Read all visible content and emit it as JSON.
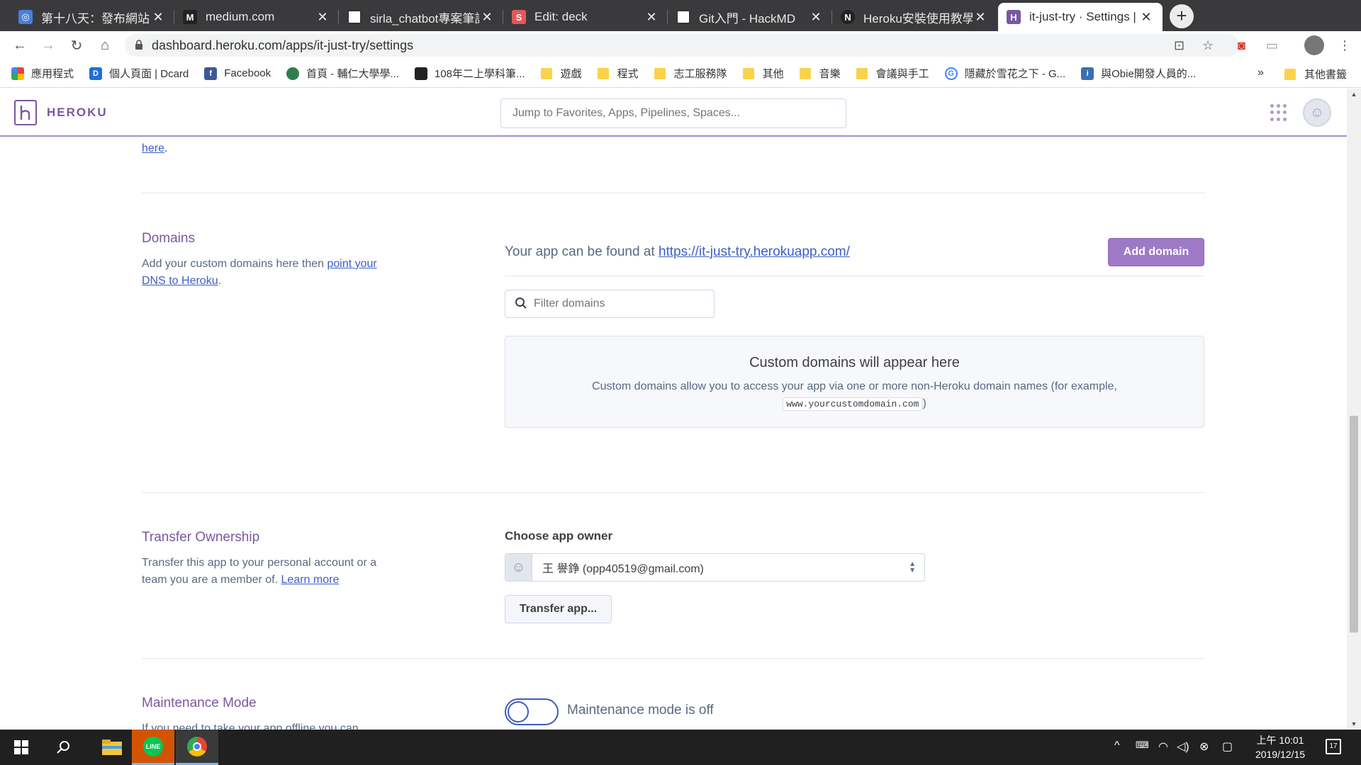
{
  "browser": {
    "tabs": [
      {
        "title": "第十八天：發布網站到",
        "favicon": "site-icon",
        "favicon_color": "#4a7fd6"
      },
      {
        "title": "medium.com",
        "favicon": "medium-icon",
        "favicon_color": "#222222"
      },
      {
        "title": "sirla_chatbot專案筆記",
        "favicon": "doc-icon",
        "favicon_color": "#333333"
      },
      {
        "title": "Edit: deck",
        "favicon": "slides-icon",
        "favicon_color": "#e05a5a"
      },
      {
        "title": "Git入門 - HackMD",
        "favicon": "doc-icon",
        "favicon_color": "#333333"
      },
      {
        "title": "Heroku安裝使用教學",
        "favicon": "notion-icon",
        "favicon_color": "#222222"
      },
      {
        "title": "it-just-try · Settings | H",
        "favicon": "heroku-icon",
        "favicon_color": "#79589f"
      }
    ],
    "new_tab_label": "+",
    "address": "dashboard.heroku.com/apps/it-just-try/settings",
    "bookmarks": [
      {
        "label": "應用程式",
        "icon": "apps-grid-icon",
        "color": "#e94235"
      },
      {
        "label": "個人頁面 | Dcard",
        "icon": "dcard-icon",
        "color": "#1f6fd6"
      },
      {
        "label": "Facebook",
        "icon": "facebook-icon",
        "color": "#3b5998"
      },
      {
        "label": "首頁 - 輔仁大學學...",
        "icon": "school-icon",
        "color": "#2f7d4f"
      },
      {
        "label": "108年二上學科筆...",
        "icon": "doc-icon",
        "color": "#222222"
      },
      {
        "label": "遊戲",
        "icon": "folder-icon",
        "color": "#f9d34c"
      },
      {
        "label": "程式",
        "icon": "folder-icon",
        "color": "#f9d34c"
      },
      {
        "label": "志工服務隊",
        "icon": "folder-icon",
        "color": "#f9d34c"
      },
      {
        "label": "其他",
        "icon": "folder-icon",
        "color": "#f9d34c"
      },
      {
        "label": "音樂",
        "icon": "folder-icon",
        "color": "#f9d34c"
      },
      {
        "label": "會議與手工",
        "icon": "folder-icon",
        "color": "#f9d34c"
      },
      {
        "label": "隱藏於雪花之下 - G...",
        "icon": "google-icon",
        "color": "#4285f4"
      },
      {
        "label": "與Obie開發人員的...",
        "icon": "info-icon",
        "color": "#3a6fb0"
      }
    ],
    "bookmarks_more": "»",
    "other_bookmarks": "其他書籤"
  },
  "heroku": {
    "logo_text": "HEROKU",
    "search_placeholder": "Jump to Favorites, Apps, Pipelines, Spaces...",
    "accent": "#79589f"
  },
  "top_cut": {
    "link": "here",
    "suffix": "."
  },
  "domains": {
    "title": "Domains",
    "desc_prefix": "Add your custom domains here then ",
    "desc_link": "point your DNS to Heroku",
    "desc_suffix": ".",
    "found_prefix": "Your app can be found at ",
    "found_link": "https://it-just-try.herokuapp.com/",
    "add_button": "Add domain",
    "filter_placeholder": "Filter domains",
    "empty_title": "Custom domains will appear here",
    "empty_text": "Custom domains allow you to access your app via one or more non-Heroku domain names (for example,",
    "empty_code": "www.yourcustomdomain.com",
    "empty_close": ")"
  },
  "transfer": {
    "title": "Transfer Ownership",
    "desc_prefix": "Transfer this app to your personal account or a team you are a member of. ",
    "desc_link": "Learn more",
    "owner_label": "Choose app owner",
    "owner_value": "王 譽錚 (opp40519@gmail.com)",
    "transfer_button": "Transfer app..."
  },
  "maintenance": {
    "title": "Maintenance Mode",
    "desc_cut": "If you need to take your app offline you can",
    "toggle_label": "Maintenance mode is off",
    "enabled": false
  },
  "taskbar": {
    "clock_period": "上午 10:01",
    "date": "2019/12/15",
    "notifications": "17"
  }
}
